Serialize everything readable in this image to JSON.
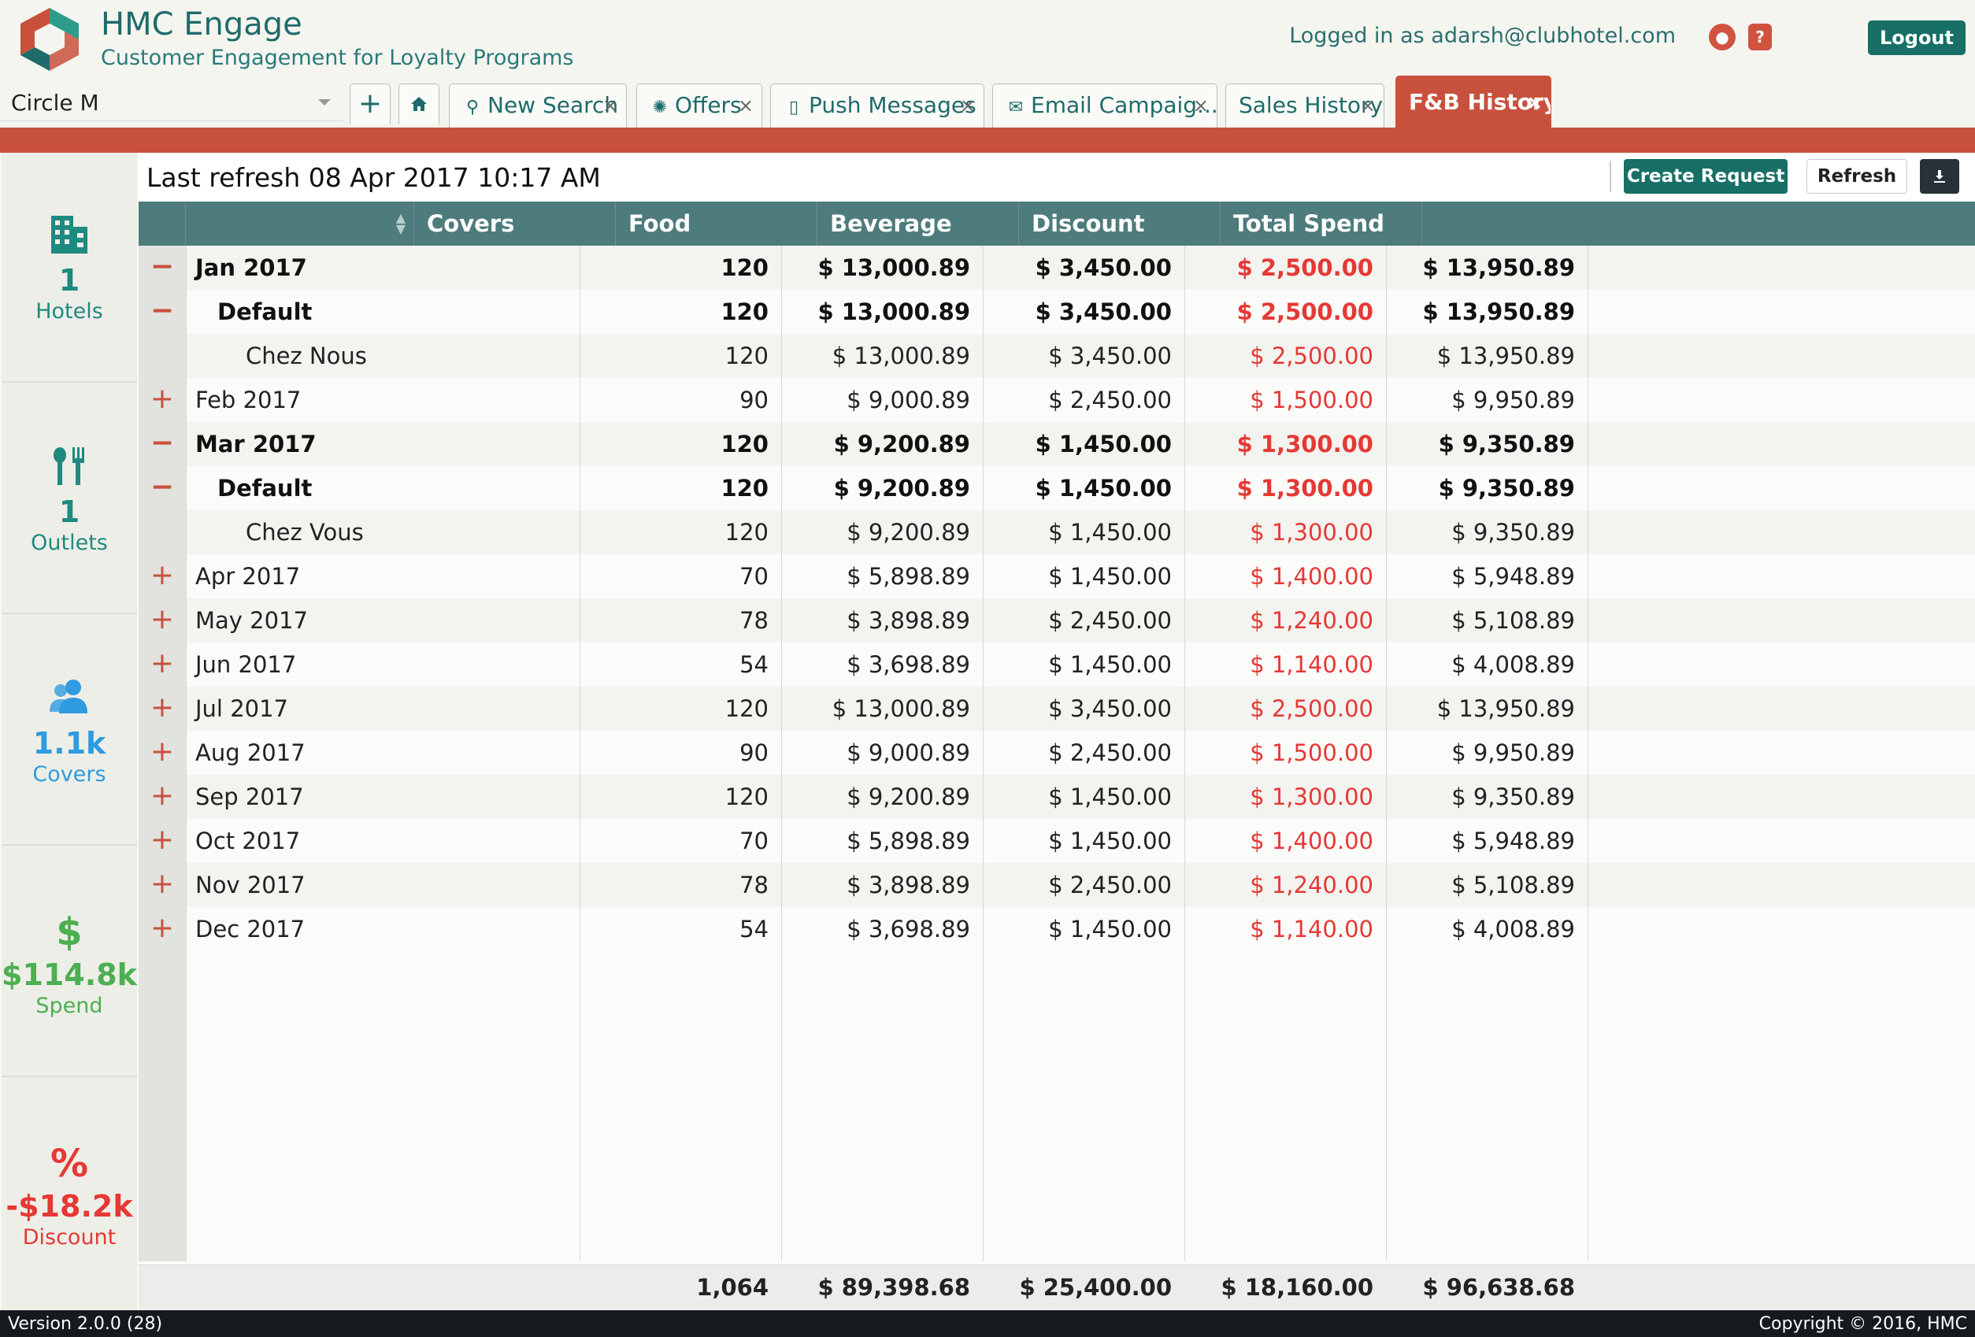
{
  "app": {
    "title": "HMC Engage",
    "subtitle": "Customer Engagement for Loyalty Programs",
    "logged_in": "Logged in as adarsh@clubhotel.com",
    "logout_label": "Logout"
  },
  "hotel_select": {
    "value": "Circle M"
  },
  "tabs": [
    {
      "label": "New Search",
      "icon": "search-icon"
    },
    {
      "label": "Offers",
      "icon": "gear-icon"
    },
    {
      "label": "Push Messages",
      "icon": "phone-icon"
    },
    {
      "label": "Email Campaig...",
      "icon": "envelope-icon"
    },
    {
      "label": "Sales History",
      "icon": ""
    },
    {
      "label": "F&B History",
      "icon": "",
      "active": true
    }
  ],
  "sidebar": {
    "hotels": {
      "value": "1",
      "label": "Hotels",
      "color": "#1f8a80"
    },
    "outlets": {
      "value": "1",
      "label": "Outlets",
      "color": "#1f8a80"
    },
    "covers": {
      "value": "1.1k",
      "label": "Covers",
      "color": "#2f9be0"
    },
    "spend": {
      "value": "$114.8k",
      "label": "Spend",
      "color": "#4caf50"
    },
    "discount": {
      "value": "-$18.2k",
      "label": "Discount",
      "color": "#e53935"
    }
  },
  "toolbar": {
    "last_refresh": "Last refresh 08 Apr 2017 10:17 AM",
    "create_label": "Create Request",
    "refresh_label": "Refresh"
  },
  "table": {
    "columns": [
      "",
      "Covers",
      "Food",
      "Beverage",
      "Discount",
      "Total Spend"
    ],
    "rows": [
      {
        "toggle": "−",
        "label": "Jan 2017",
        "level": 0,
        "bold": true,
        "covers": "120",
        "food": "$ 13,000.89",
        "beverage": "$ 3,450.00",
        "discount": "$ 2,500.00",
        "total": "$ 13,950.89"
      },
      {
        "toggle": "−",
        "label": "Default",
        "level": 1,
        "bold": true,
        "covers": "120",
        "food": "$ 13,000.89",
        "beverage": "$ 3,450.00",
        "discount": "$ 2,500.00",
        "total": "$ 13,950.89"
      },
      {
        "toggle": "",
        "label": "Chez Nous",
        "level": 2,
        "bold": false,
        "covers": "120",
        "food": "$ 13,000.89",
        "beverage": "$ 3,450.00",
        "discount": "$ 2,500.00",
        "total": "$ 13,950.89"
      },
      {
        "toggle": "+",
        "label": "Feb 2017",
        "level": 0,
        "bold": false,
        "covers": "90",
        "food": "$ 9,000.89",
        "beverage": "$ 2,450.00",
        "discount": "$ 1,500.00",
        "total": "$ 9,950.89"
      },
      {
        "toggle": "−",
        "label": "Mar 2017",
        "level": 0,
        "bold": true,
        "covers": "120",
        "food": "$ 9,200.89",
        "beverage": "$ 1,450.00",
        "discount": "$ 1,300.00",
        "total": "$ 9,350.89"
      },
      {
        "toggle": "−",
        "label": "Default",
        "level": 1,
        "bold": true,
        "covers": "120",
        "food": "$ 9,200.89",
        "beverage": "$ 1,450.00",
        "discount": "$ 1,300.00",
        "total": "$ 9,350.89"
      },
      {
        "toggle": "",
        "label": "Chez Vous",
        "level": 2,
        "bold": false,
        "covers": "120",
        "food": "$ 9,200.89",
        "beverage": "$ 1,450.00",
        "discount": "$ 1,300.00",
        "total": "$ 9,350.89"
      },
      {
        "toggle": "+",
        "label": "Apr 2017",
        "level": 0,
        "bold": false,
        "covers": "70",
        "food": "$ 5,898.89",
        "beverage": "$ 1,450.00",
        "discount": "$ 1,400.00",
        "total": "$ 5,948.89"
      },
      {
        "toggle": "+",
        "label": "May 2017",
        "level": 0,
        "bold": false,
        "covers": "78",
        "food": "$ 3,898.89",
        "beverage": "$ 2,450.00",
        "discount": "$ 1,240.00",
        "total": "$ 5,108.89"
      },
      {
        "toggle": "+",
        "label": "Jun 2017",
        "level": 0,
        "bold": false,
        "covers": "54",
        "food": "$ 3,698.89",
        "beverage": "$ 1,450.00",
        "discount": "$ 1,140.00",
        "total": "$ 4,008.89"
      },
      {
        "toggle": "+",
        "label": "Jul 2017",
        "level": 0,
        "bold": false,
        "covers": "120",
        "food": "$ 13,000.89",
        "beverage": "$ 3,450.00",
        "discount": "$ 2,500.00",
        "total": "$ 13,950.89"
      },
      {
        "toggle": "+",
        "label": "Aug 2017",
        "level": 0,
        "bold": false,
        "covers": "90",
        "food": "$ 9,000.89",
        "beverage": "$ 2,450.00",
        "discount": "$ 1,500.00",
        "total": "$ 9,950.89"
      },
      {
        "toggle": "+",
        "label": "Sep 2017",
        "level": 0,
        "bold": false,
        "covers": "120",
        "food": "$ 9,200.89",
        "beverage": "$ 1,450.00",
        "discount": "$ 1,300.00",
        "total": "$ 9,350.89"
      },
      {
        "toggle": "+",
        "label": "Oct 2017",
        "level": 0,
        "bold": false,
        "covers": "70",
        "food": "$ 5,898.89",
        "beverage": "$ 1,450.00",
        "discount": "$ 1,400.00",
        "total": "$ 5,948.89"
      },
      {
        "toggle": "+",
        "label": "Nov 2017",
        "level": 0,
        "bold": false,
        "covers": "78",
        "food": "$ 3,898.89",
        "beverage": "$ 2,450.00",
        "discount": "$ 1,240.00",
        "total": "$ 5,108.89"
      },
      {
        "toggle": "+",
        "label": "Dec 2017",
        "level": 0,
        "bold": false,
        "covers": "54",
        "food": "$ 3,698.89",
        "beverage": "$ 1,450.00",
        "discount": "$ 1,140.00",
        "total": "$ 4,008.89"
      }
    ],
    "totals": {
      "covers": "1,064",
      "food": "$ 89,398.68",
      "beverage": "$ 25,400.00",
      "discount": "$ 18,160.00",
      "total": "$ 96,638.68"
    }
  },
  "footer": {
    "version": "Version 2.0.0 (28)",
    "copyright": "Copyright © 2016, HMC"
  }
}
